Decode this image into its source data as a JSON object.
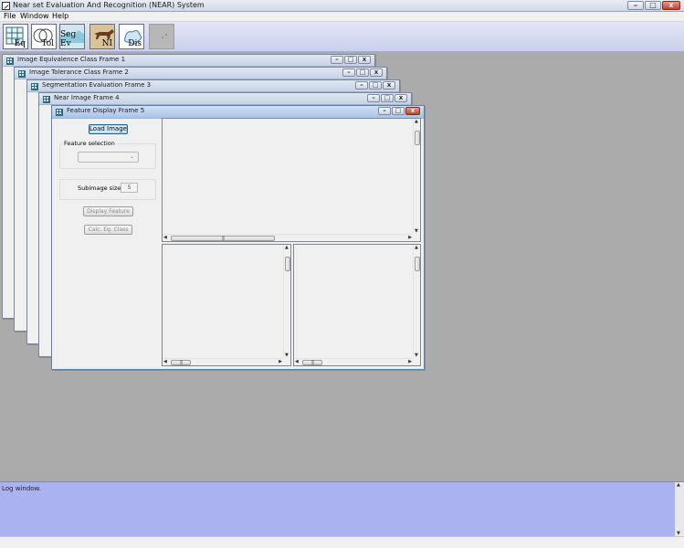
{
  "app": {
    "title": "Near set Evaluation And Recognition (NEAR) System"
  },
  "window_controls": {
    "minimize": "–",
    "maximize": "□",
    "close": "x"
  },
  "menu": {
    "file": "File",
    "window": "Window",
    "help": "Help"
  },
  "toolbar": {
    "items": [
      {
        "label": "Eq",
        "icon": "grid-icon"
      },
      {
        "label": "Tol",
        "icon": "venn-icon"
      },
      {
        "label": "Seg Ev",
        "icon": "landscape-icon"
      },
      {
        "label": "NI",
        "icon": "horse-icon"
      },
      {
        "label": "Dis",
        "icon": "splash-icon"
      },
      {
        "label": "",
        "icon": "disabled-icon"
      }
    ]
  },
  "frames": [
    {
      "title": "Image Equivalence Class Frame 1"
    },
    {
      "title": "Image Tolerance Class Frame 2"
    },
    {
      "title": "Segmentation Evaluation Frame 3"
    },
    {
      "title": "Near Image Frame 4"
    }
  ],
  "active_frame": {
    "title": "Feature Display Frame 5",
    "load_image": "Load Image",
    "feature_selection_label": "Feature selection",
    "feature_selected": "",
    "subimage_label": "Subimage size:",
    "subimage_value": "5",
    "display_feature": "Display Feature",
    "calc_eq_class": "Calc. Eq. Class"
  },
  "scroll": {
    "up": "▲",
    "down": "▼",
    "left": "◀",
    "right": "▶",
    "grip": "|||"
  },
  "log": {
    "text": "Log window."
  }
}
